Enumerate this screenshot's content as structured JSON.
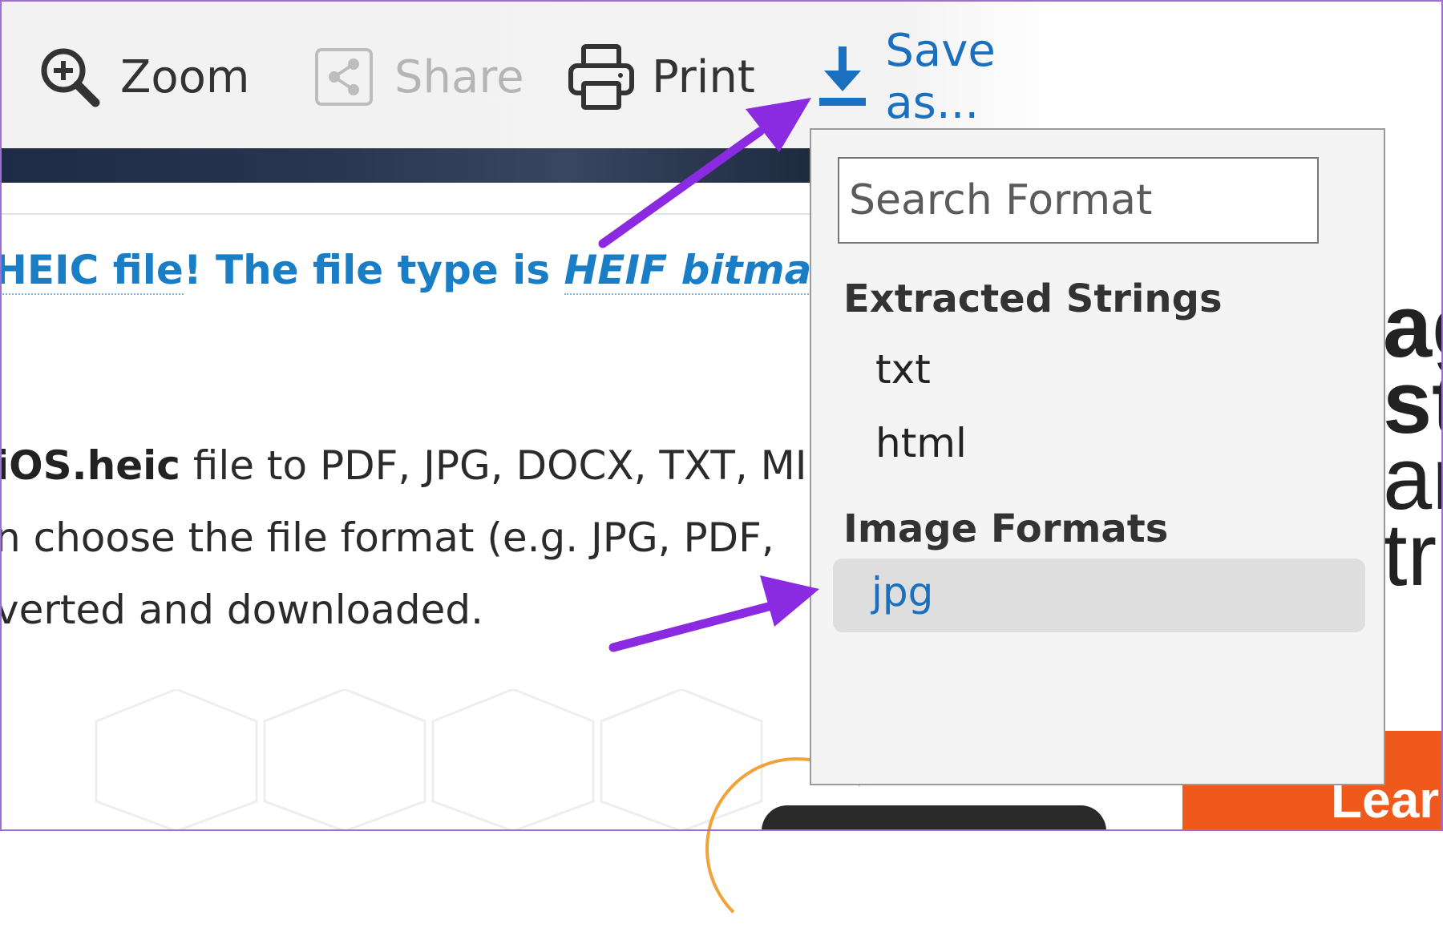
{
  "toolbar": {
    "zoom_label": "Zoom",
    "share_label": "Share",
    "print_label": "Print",
    "save_label": "Save as..."
  },
  "article": {
    "heading_part1": "HEIC file",
    "heading_part2": "! The file type is ",
    "heading_italic": "HEIF bitmap (h",
    "line1_bold": "iOS.heic",
    "line1_rest": " file to PDF, JPG, DOCX, TXT, MI",
    "line2": "n choose the file format (e.g. JPG, PDF,",
    "line3": "verted and downloaded."
  },
  "background": {
    "right_letters": [
      "ag",
      "st",
      "an",
      "tr"
    ],
    "button_label": "Lear"
  },
  "dropdown": {
    "search_placeholder": "Search Format",
    "groups": [
      {
        "label": "Extracted Strings",
        "options": [
          "txt",
          "html"
        ]
      },
      {
        "label": "Image Formats",
        "options": [
          "jpg"
        ],
        "selected": "jpg"
      }
    ]
  },
  "colors": {
    "accent_blue": "#1b6fbf",
    "heading_blue": "#1a7ec7",
    "annotation_purple": "#8a2be2",
    "orange": "#ef5a1c"
  }
}
